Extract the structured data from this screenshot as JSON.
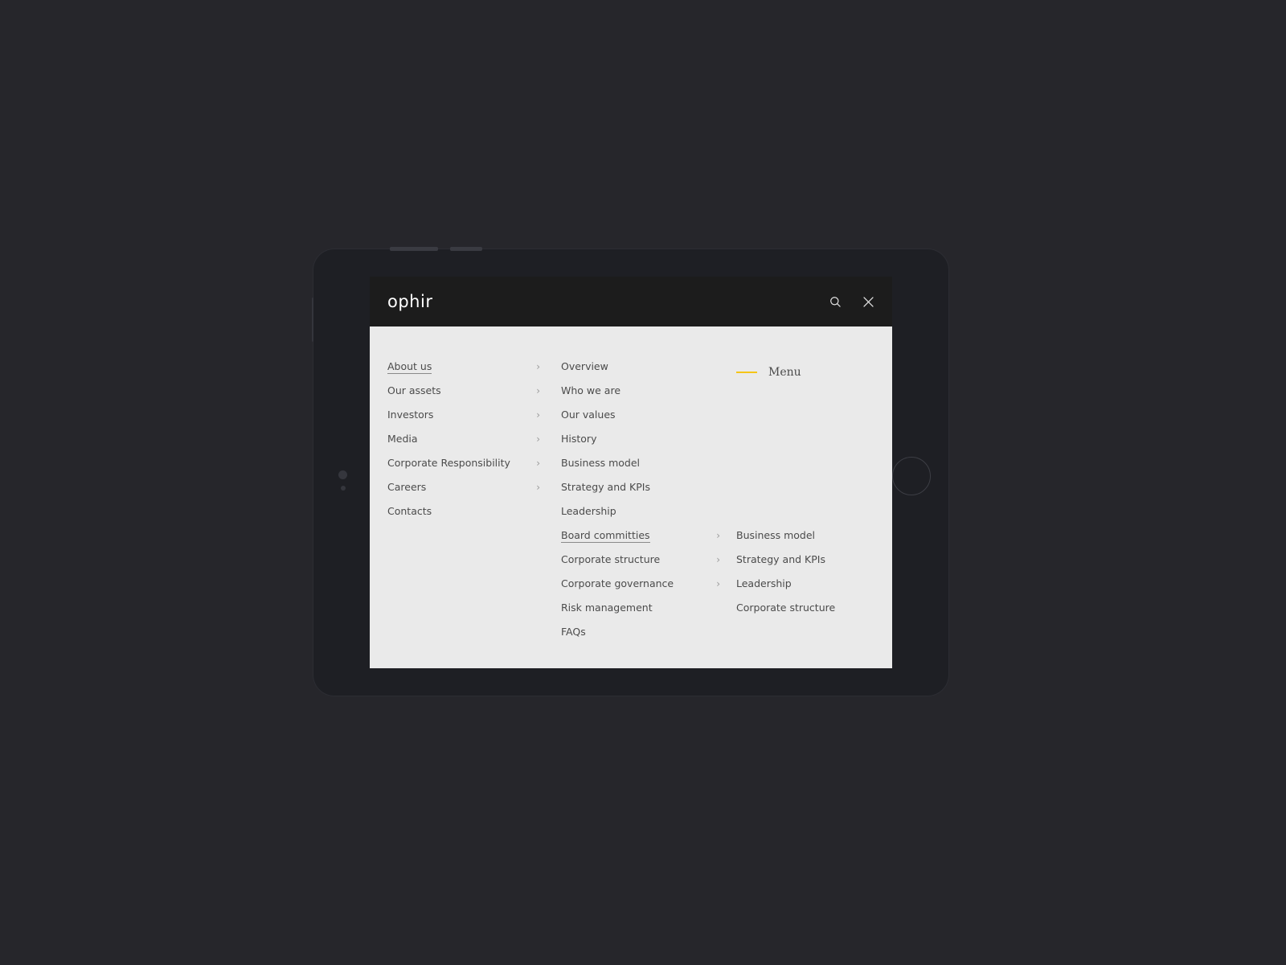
{
  "theme": {
    "page_background": "#26262b",
    "device_body": "#1e1f24",
    "topbar_background": "#1c1c1c",
    "panel_background": "#eaeaea",
    "accent": "#f5c518",
    "text": "#4b4b4b",
    "logo_color": "#ffffff"
  },
  "topbar": {
    "logo": "ophir",
    "search_icon": "search-icon",
    "close_icon": "close-icon"
  },
  "menu": {
    "primary": [
      {
        "label": "About us",
        "has_chevron": true,
        "active": true
      },
      {
        "label": "Our assets",
        "has_chevron": true,
        "active": false
      },
      {
        "label": "Investors",
        "has_chevron": true,
        "active": false
      },
      {
        "label": "Media",
        "has_chevron": true,
        "active": false
      },
      {
        "label": "Corporate Responsibility",
        "has_chevron": true,
        "active": false
      },
      {
        "label": "Careers",
        "has_chevron": true,
        "active": false
      },
      {
        "label": "Contacts",
        "has_chevron": false,
        "active": false
      }
    ],
    "secondary": [
      {
        "label": "Overview",
        "has_chevron": false,
        "active": false
      },
      {
        "label": "Who we are",
        "has_chevron": false,
        "active": false
      },
      {
        "label": "Our values",
        "has_chevron": false,
        "active": false
      },
      {
        "label": "History",
        "has_chevron": false,
        "active": false
      },
      {
        "label": "Business model",
        "has_chevron": false,
        "active": false
      },
      {
        "label": "Strategy and KPIs",
        "has_chevron": false,
        "active": false
      },
      {
        "label": "Leadership",
        "has_chevron": false,
        "active": false
      },
      {
        "label": "Board committies",
        "has_chevron": true,
        "active": true
      },
      {
        "label": "Corporate structure",
        "has_chevron": true,
        "active": false
      },
      {
        "label": "Corporate governance",
        "has_chevron": true,
        "active": false
      },
      {
        "label": "Risk management",
        "has_chevron": false,
        "active": false
      },
      {
        "label": "FAQs",
        "has_chevron": false,
        "active": false
      }
    ],
    "tertiary_title": "Menu",
    "tertiary": [
      {
        "label": "Business model",
        "has_chevron": false,
        "active": false
      },
      {
        "label": "Strategy and KPIs",
        "has_chevron": false,
        "active": false
      },
      {
        "label": "Leadership",
        "has_chevron": false,
        "active": false
      },
      {
        "label": "Corporate structure",
        "has_chevron": false,
        "active": false
      }
    ]
  },
  "device": {
    "home_button": "home-button",
    "camera_sensor": "camera-sensor",
    "ambient_sensor": "ambient-light-sensor"
  }
}
